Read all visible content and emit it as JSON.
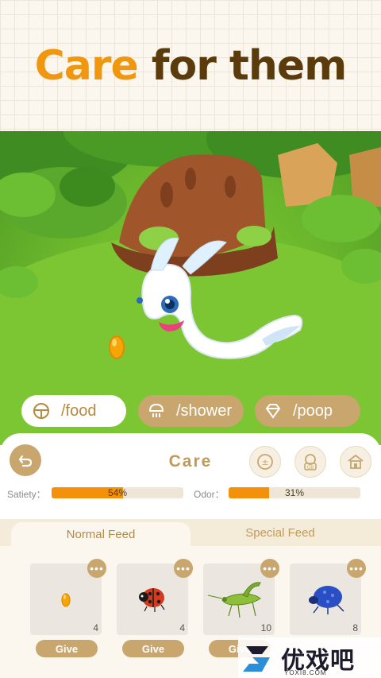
{
  "header": {
    "headline_accent": "Care",
    "headline_rest": "for them"
  },
  "commands": [
    {
      "label": "/food",
      "icon": "food-icon"
    },
    {
      "label": "/shower",
      "icon": "shower-icon"
    },
    {
      "label": "/poop",
      "icon": "poop-icon"
    }
  ],
  "panel": {
    "title": "Care",
    "icons": [
      "back-arrow-icon",
      "balance-icon",
      "gb-icon",
      "house-icon"
    ],
    "stats": {
      "satiety": {
        "label": "Satiety：",
        "value": "54%",
        "fraction": 0.54
      },
      "odor": {
        "label": "Odor：",
        "value": "31%",
        "fraction": 0.31
      }
    },
    "tabs": {
      "normal": "Normal Feed",
      "special": "Special Feed"
    },
    "cards": [
      {
        "item": "golden-seed",
        "count": "4",
        "button": "Give"
      },
      {
        "item": "ladybug",
        "count": "4",
        "button": "Give"
      },
      {
        "item": "grasshopper",
        "count": "10",
        "button": "Give"
      },
      {
        "item": "blue-beetle",
        "count": "8",
        "button": "Give"
      }
    ],
    "more_glyph": "•••"
  },
  "watermark": {
    "text": "优戏吧",
    "sub": "YOXI8.COM"
  },
  "colors": {
    "accent": "#f0960f",
    "brown": "#5b3b0c",
    "tan": "#c8a66d",
    "bar": "#f3920a"
  }
}
